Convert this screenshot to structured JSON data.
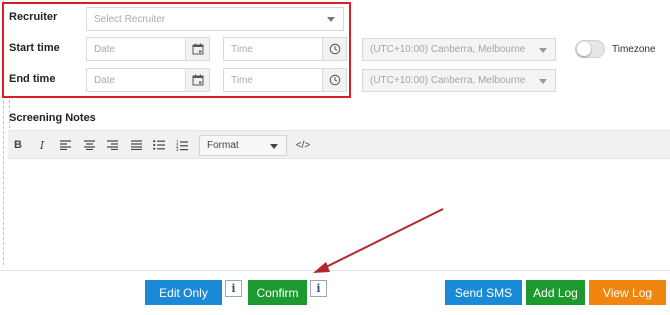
{
  "form": {
    "recruiter": {
      "label": "Recruiter",
      "placeholder": "Select Recruiter"
    },
    "start_time": {
      "label": "Start time",
      "date_placeholder": "Date",
      "time_placeholder": "Time",
      "timezone": "(UTC+10:00) Canberra, Melbourne"
    },
    "end_time": {
      "label": "End time",
      "date_placeholder": "Date",
      "time_placeholder": "Time",
      "timezone": "(UTC+10:00) Canberra, Melbourne"
    },
    "timezone_toggle": {
      "label": "Timezone",
      "on": false
    }
  },
  "editor": {
    "title": "Screening Notes",
    "toolbar": {
      "bold": "B",
      "italic": "I",
      "format_label": "Format",
      "code": "</>"
    }
  },
  "buttons": {
    "edit_only": "Edit Only",
    "confirm": "Confirm",
    "info": "i",
    "send_sms": "Send SMS",
    "add_log": "Add Log",
    "view_log": "View Log"
  },
  "colors": {
    "highlight": "#d62028",
    "edit_only": "#1a8ad6",
    "confirm": "#1c9a2e",
    "send_sms": "#1a8ad6",
    "add_log": "#1c9a2e",
    "view_log": "#f0850f",
    "arrow": "#b2282c"
  },
  "icons": {
    "calendar": "calendar-icon",
    "clock": "clock-icon",
    "dropdown": "chevron-down-icon"
  }
}
